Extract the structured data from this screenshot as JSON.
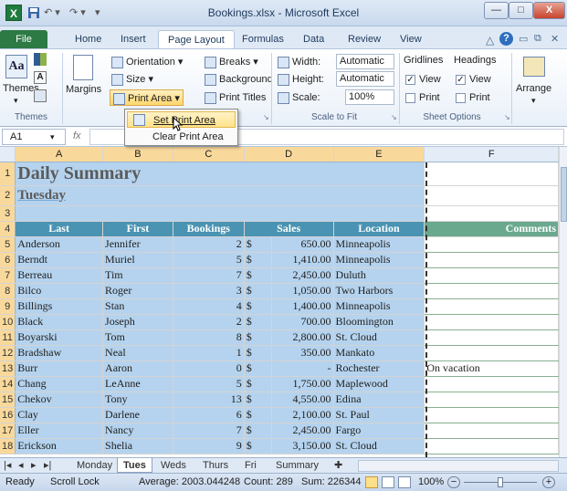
{
  "window": {
    "title": "Bookings.xlsx - Microsoft Excel",
    "app_letter": "X",
    "undo": "↶ ▾",
    "redo": "↷ ▾",
    "qat_more": "▾",
    "minimize": "—",
    "maximize": "□",
    "close": "X"
  },
  "ribbon_tabs": [
    "File",
    "Home",
    "Insert",
    "Page Layout",
    "Formulas",
    "Data",
    "Review",
    "View"
  ],
  "ribbon_right_icons": [
    "△",
    "?",
    "▭",
    "⧉",
    "✕"
  ],
  "ribbon": {
    "themes": {
      "label": "Themes",
      "group": "Themes"
    },
    "page_setup": {
      "margins": "Margins",
      "orientation": "Orientation ▾",
      "size": "Size ▾",
      "print_area": "Print Area ▾",
      "breaks": "Breaks ▾",
      "background": "Background",
      "print_titles": "Print Titles",
      "group": "Page Setup"
    },
    "scale_to_fit": {
      "width_label": "Width:",
      "width_value": "Automatic",
      "height_label": "Height:",
      "height_value": "Automatic",
      "scale_label": "Scale:",
      "scale_value": "100%",
      "group": "Scale to Fit"
    },
    "sheet_options": {
      "gridlines": "Gridlines",
      "headings": "Headings",
      "view": "View",
      "print": "Print",
      "gridlines_view": true,
      "gridlines_print": false,
      "headings_view": true,
      "headings_print": false,
      "group": "Sheet Options"
    },
    "arrange": {
      "label": "Arrange"
    }
  },
  "dropdown": {
    "items": [
      "Set Print Area",
      "Clear Print Area"
    ]
  },
  "formula_bar": {
    "name_box": "A1",
    "fx": "fx"
  },
  "columns": [
    "A",
    "B",
    "C",
    "D",
    "E",
    "F"
  ],
  "sheet": {
    "title": "Daily Summary",
    "subtitle": "Tuesday",
    "headers": [
      "Last",
      "First",
      "Bookings",
      "Sales",
      "Location",
      "Comments"
    ],
    "row_numbers": [
      "1",
      "2",
      "3",
      "4",
      "5",
      "6",
      "7",
      "8",
      "9",
      "10",
      "11",
      "12",
      "13",
      "14",
      "15",
      "16",
      "17",
      "18"
    ],
    "rows": [
      [
        "Anderson",
        "Jennifer",
        "2",
        "$",
        "650.00",
        "Minneapolis",
        ""
      ],
      [
        "Berndt",
        "Muriel",
        "5",
        "$",
        "1,410.00",
        "Minneapolis",
        ""
      ],
      [
        "Berreau",
        "Tim",
        "7",
        "$",
        "2,450.00",
        "Duluth",
        ""
      ],
      [
        "Bilco",
        "Roger",
        "3",
        "$",
        "1,050.00",
        "Two Harbors",
        ""
      ],
      [
        "Billings",
        "Stan",
        "4",
        "$",
        "1,400.00",
        "Minneapolis",
        ""
      ],
      [
        "Black",
        "Joseph",
        "2",
        "$",
        "700.00",
        "Bloomington",
        ""
      ],
      [
        "Boyarski",
        "Tom",
        "8",
        "$",
        "2,800.00",
        "St. Cloud",
        ""
      ],
      [
        "Bradshaw",
        "Neal",
        "1",
        "$",
        "350.00",
        "Mankato",
        ""
      ],
      [
        "Burr",
        "Aaron",
        "0",
        "$",
        "-",
        "Rochester",
        "On vacation"
      ],
      [
        "Chang",
        "LeAnne",
        "5",
        "$",
        "1,750.00",
        "Maplewood",
        ""
      ],
      [
        "Chekov",
        "Tony",
        "13",
        "$",
        "4,550.00",
        "Edina",
        ""
      ],
      [
        "Clay",
        "Darlene",
        "6",
        "$",
        "2,100.00",
        "St. Paul",
        ""
      ],
      [
        "Eller",
        "Nancy",
        "7",
        "$",
        "2,450.00",
        "Fargo",
        ""
      ],
      [
        "Erickson",
        "Shelia",
        "9",
        "$",
        "3,150.00",
        "St. Cloud",
        ""
      ]
    ]
  },
  "sheet_tabs": [
    "Monday",
    "Tues",
    "Weds",
    "Thurs",
    "Fri",
    "Summary"
  ],
  "sheet_nav": [
    "|◂",
    "◂",
    "▸",
    "▸|"
  ],
  "status": {
    "ready": "Ready",
    "scroll_lock": "Scroll Lock",
    "average": "Average: 2003.044248",
    "count": "Count: 289",
    "sum": "Sum: 226344",
    "zoom": "100%",
    "zoom_out": "−",
    "zoom_in": "+"
  }
}
